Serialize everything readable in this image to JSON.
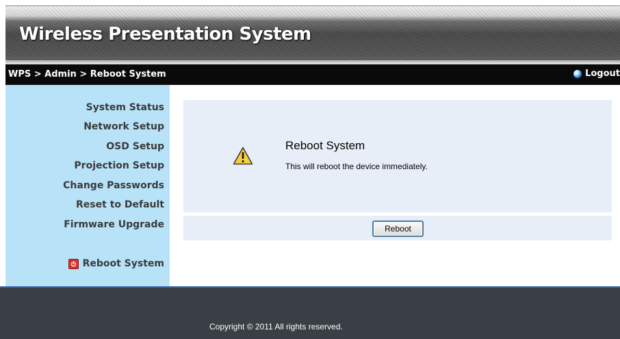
{
  "app": {
    "title": "Wireless Presentation System"
  },
  "breadcrumb": {
    "text": "WPS > Admin > Reboot System"
  },
  "logout": {
    "label": "Logout",
    "icon": "logout-globe-icon"
  },
  "sidebar": {
    "items": [
      {
        "label": "System Status"
      },
      {
        "label": "Network Setup"
      },
      {
        "label": "OSD Setup"
      },
      {
        "label": "Projection Setup"
      },
      {
        "label": "Change Passwords"
      },
      {
        "label": "Reset to Default"
      },
      {
        "label": "Firmware Upgrade"
      },
      {
        "label": "Reboot System",
        "icon": "power-icon",
        "active": true
      }
    ]
  },
  "main": {
    "title": "Reboot System",
    "description": "This will reboot the device immediately.",
    "icon": "warning-icon",
    "button_label": "Reboot"
  },
  "footer": {
    "copyright": "Copyright © 2011 All rights reserved."
  },
  "colors": {
    "sidebar_bg": "#b8e2f8",
    "breadcrumb_bg": "#0a0a0a",
    "panel_bg": "#e8eef8",
    "footer_bg": "#3a3f45",
    "warning_yellow": "#f6d23a"
  }
}
